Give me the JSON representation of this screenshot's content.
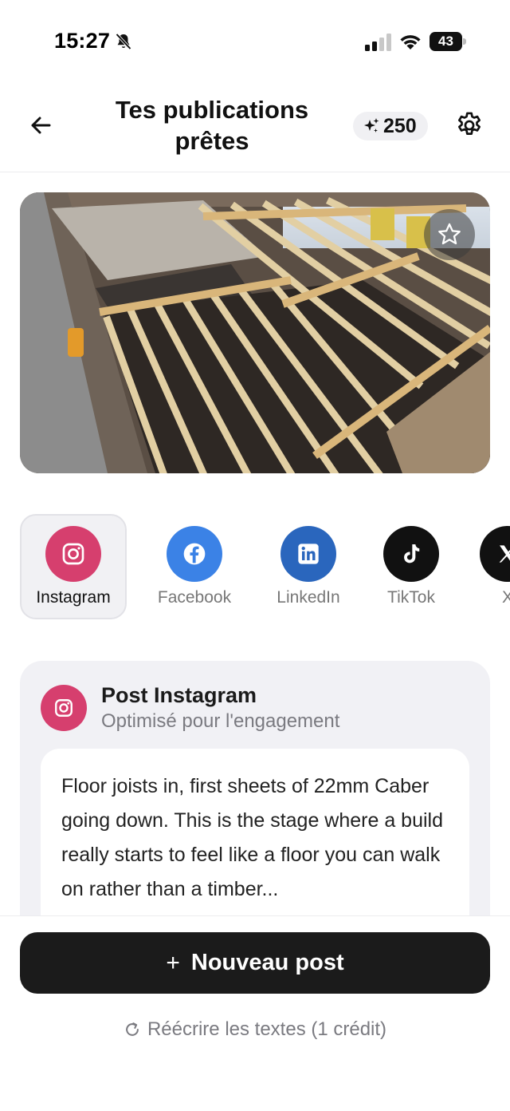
{
  "status_bar": {
    "time": "15:27",
    "battery": "43"
  },
  "header": {
    "title": "Tes publications prêtes",
    "credits": "250"
  },
  "platforms": [
    {
      "label": "Instagram",
      "color": "#d63f6e",
      "icon": "instagram-icon",
      "selected": true
    },
    {
      "label": "Facebook",
      "color": "#3b82e6",
      "icon": "facebook-icon",
      "selected": false
    },
    {
      "label": "LinkedIn",
      "color": "#2a66bd",
      "icon": "linkedin-icon",
      "selected": false
    },
    {
      "label": "TikTok",
      "color": "#111111",
      "icon": "tiktok-icon",
      "selected": false
    },
    {
      "label": "X",
      "color": "#111111",
      "icon": "x-icon",
      "selected": false
    }
  ],
  "post": {
    "title": "Post Instagram",
    "subtitle": "Optimisé pour l'engagement",
    "text": "Floor joists in, first sheets of 22mm Caber going down. This is the stage where a build really starts to feel like a floor you can walk on rather than a timber..."
  },
  "actions": {
    "new_post": "Nouveau post",
    "rewrite": "Réécrire les textes (1 crédit)"
  },
  "colors": {
    "accent_dark": "#1b1b1b",
    "instagram": "#d63f6e",
    "facebook": "#3b82e6",
    "linkedin": "#2a66bd"
  }
}
